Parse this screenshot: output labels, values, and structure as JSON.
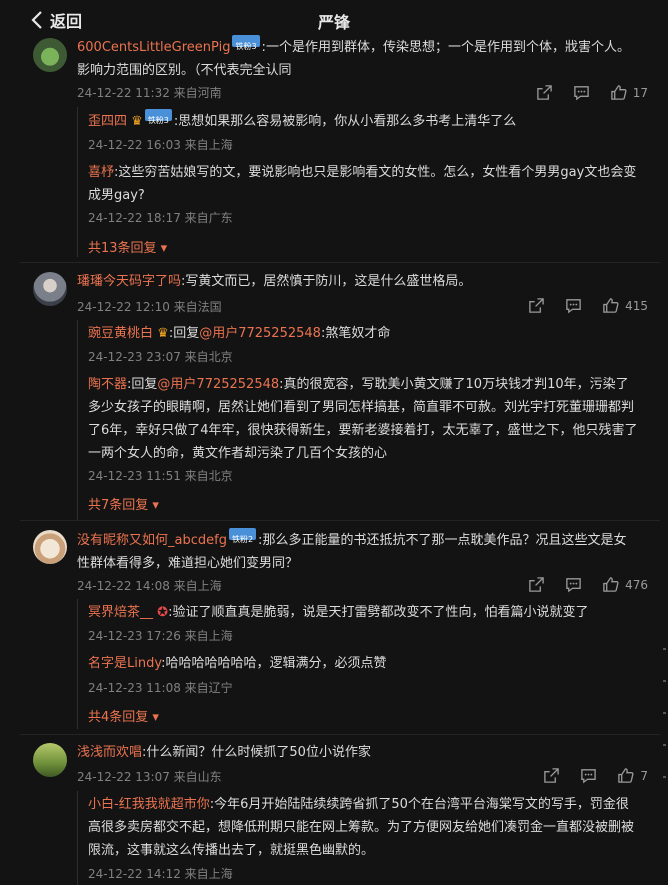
{
  "header": {
    "back_label": "返回",
    "title": "严锋"
  },
  "comments": [
    {
      "user": "600CentsLittleGreenPig",
      "badge": "铁粉3",
      "text": "一个是作用到群体，传染思想；一个是作用到个体，戕害个人。影响力范围的区别。（不代表完全认同",
      "meta": "24-12-22 11:32 来自河南",
      "likes": "17",
      "replies": [
        {
          "user": "歪四四",
          "badge": "铁粉3",
          "text": "思想如果那么容易被影响，你从小看那么多书考上清华了么",
          "meta": "24-12-22 16:03 来自上海"
        },
        {
          "user": "喜杼",
          "text": "这些穷苦姑娘写的文，要说影响也只是影响看文的女性。怎么，女性看个男男gay文也会变成男gay?",
          "meta": "24-12-22 18:17 来自广东"
        }
      ],
      "more": "共13条回复"
    },
    {
      "user": "璠璠今天码字了吗",
      "text": "写黄文而已，居然慎于防川，这是什么盛世格局。",
      "meta": "24-12-22 12:10 来自法国",
      "likes": "415",
      "replies": [
        {
          "user": "豌豆黄桃白",
          "text": "回复",
          "mention": "@用户7725252548",
          "text2": ":煞笔奴才命",
          "meta": "24-12-23 23:07 来自北京"
        },
        {
          "user": "陶不器",
          "text": "回复",
          "mention": "@用户7725252548",
          "text2": ":真的很宽容，写耽美小黄文赚了10万块钱才判10年，污染了多少女孩子的眼睛啊，居然让她们看到了男同怎样搞基，简直罪不可赦。刘光宇打死董珊珊都判了6年，幸好只做了4年牢，很快获得新生，要新老婆接着打，太无辜了，盛世之下，他只残害了一两个女人的命，黄文作者却污染了几百个女孩的心",
          "meta": "24-12-23 11:51 来自北京"
        }
      ],
      "more": "共7条回复"
    },
    {
      "user": "没有昵称又如何_abcdefg",
      "badge": "铁粉2",
      "text": "那么多正能量的书还抵抗不了那一点耽美作品？况且这些文是女性群体看得多，难道担心她们变男同？",
      "meta": "24-12-22 14:08 来自上海",
      "likes": "476",
      "replies": [
        {
          "user": "冥界焙茶__",
          "text": "验证了顺直真是脆弱，说是天打雷劈都改变不了性向，怕看篇小说就变了",
          "meta": "24-12-23 17:26 来自上海"
        },
        {
          "user": "名字是Lindy",
          "text": "哈哈哈哈哈哈哈，逻辑满分，必须点赞",
          "meta": "24-12-23 11:08 来自辽宁"
        }
      ],
      "more": "共4条回复"
    },
    {
      "user": "浅浅而欢唱",
      "text": "什么新闻？什么时候抓了50位小说作家",
      "meta": "24-12-22 13:07 来自山东",
      "likes": "7",
      "replies": [
        {
          "user": "小白-红我我就超市你",
          "text": "今年6月开始陆陆续续跨省抓了50个在台湾平台海棠写文的写手，罚金很高很多卖房都交不起，想降低刑期只能在网上筹款。为了方便网友给她们凑罚金一直都没被删被限流，这事就这么传播出去了，就挺黑色幽默的。",
          "meta": "24-12-22 14:12 来自上海"
        }
      ]
    }
  ],
  "colors": {
    "accent": "#eb7350",
    "background": "#131313",
    "meta": "#808080"
  },
  "icons": [
    "chevron-left-icon",
    "share-icon",
    "comment-icon",
    "like-icon",
    "crown-icon"
  ]
}
